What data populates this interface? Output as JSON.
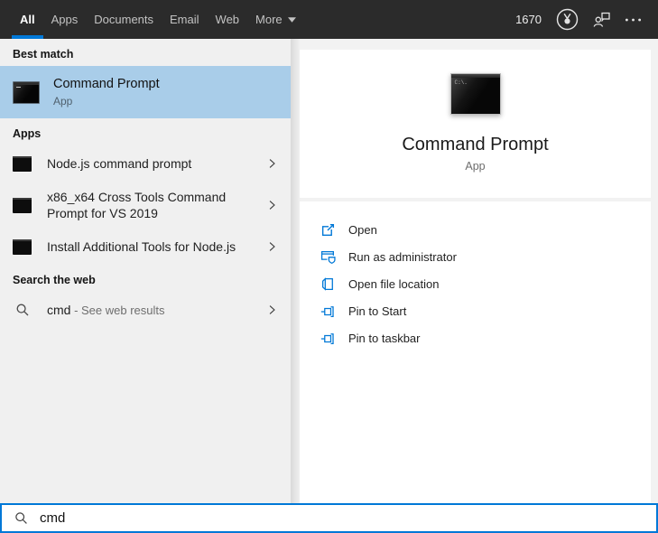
{
  "topbar": {
    "tabs": [
      {
        "label": "All",
        "selected": true
      },
      {
        "label": "Apps",
        "selected": false
      },
      {
        "label": "Documents",
        "selected": false
      },
      {
        "label": "Email",
        "selected": false
      },
      {
        "label": "Web",
        "selected": false
      },
      {
        "label": "More",
        "selected": false,
        "has_dropdown": true
      }
    ],
    "rewards_points": "1670",
    "icons": [
      "rewards-medal-icon",
      "feedback-person-icon",
      "ellipsis-icon"
    ]
  },
  "left_panel": {
    "best_match": {
      "heading": "Best match",
      "item": {
        "title": "Command Prompt",
        "subtitle": "App",
        "icon": "command-prompt-icon",
        "selected": true
      }
    },
    "apps": {
      "heading": "Apps",
      "items": [
        {
          "title": "Node.js command prompt",
          "icon": "terminal-icon",
          "chevron": true
        },
        {
          "title": "x86_x64 Cross Tools Command Prompt for VS 2019",
          "icon": "terminal-icon",
          "chevron": true
        },
        {
          "title": "Install Additional Tools for Node.js",
          "icon": "terminal-icon",
          "chevron": true
        }
      ]
    },
    "web": {
      "heading": "Search the web",
      "item": {
        "query": "cmd",
        "suffix": " - See web results",
        "icon": "search-icon",
        "chevron": true
      }
    }
  },
  "preview": {
    "title": "Command Prompt",
    "subtitle": "App",
    "icon": "command-prompt-icon-large",
    "actions": [
      {
        "label": "Open",
        "icon": "open-window-icon"
      },
      {
        "label": "Run as administrator",
        "icon": "admin-shield-icon"
      },
      {
        "label": "Open file location",
        "icon": "file-location-icon"
      },
      {
        "label": "Pin to Start",
        "icon": "pin-icon"
      },
      {
        "label": "Pin to taskbar",
        "icon": "pin-icon"
      }
    ]
  },
  "search_bar": {
    "value": "cmd",
    "icon": "search-icon"
  },
  "colors": {
    "accent": "#0078d7",
    "topbar_bg": "#2b2b2b",
    "best_match_highlight": "#a9cde9",
    "left_panel_bg": "#f0f0f0",
    "right_panel_bg": "#f2f2f2",
    "card_bg": "#ffffff"
  }
}
